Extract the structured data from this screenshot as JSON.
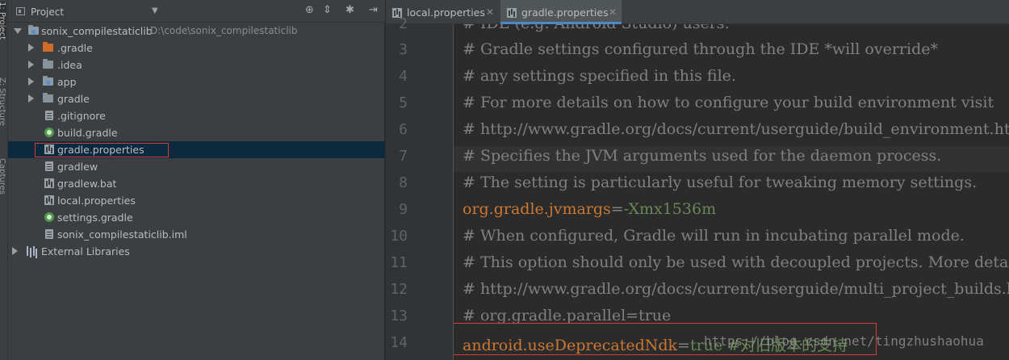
{
  "tool_strip": {
    "project": "1: Project",
    "structure": "Z: Structure",
    "captures": "Captures"
  },
  "project_panel": {
    "title": "Project",
    "header_buttons": [
      "target-icon",
      "collapse-icon",
      "gear-icon",
      "hide-icon"
    ],
    "tree": [
      {
        "label": "sonix_compilestaticlib",
        "path": "D:\\code\\sonix_compilestaticlib",
        "icon": "module-folder-icon",
        "expanded": true
      },
      {
        "label": ".gradle",
        "icon": "folder-icon-orange"
      },
      {
        "label": ".idea",
        "icon": "folder-icon"
      },
      {
        "label": "app",
        "icon": "module-folder-icon"
      },
      {
        "label": "gradle",
        "icon": "folder-icon"
      },
      {
        "label": ".gitignore",
        "icon": "file-icon"
      },
      {
        "label": "build.gradle",
        "icon": "gradle-icon"
      },
      {
        "label": "gradle.properties",
        "icon": "properties-icon",
        "selected": true
      },
      {
        "label": "gradlew",
        "icon": "file-icon"
      },
      {
        "label": "gradlew.bat",
        "icon": "file-icon"
      },
      {
        "label": "local.properties",
        "icon": "properties-icon"
      },
      {
        "label": "settings.gradle",
        "icon": "gradle-icon"
      },
      {
        "label": "sonix_compilestaticlib.iml",
        "icon": "file-icon"
      },
      {
        "label": "External Libraries",
        "icon": "library-icon"
      }
    ]
  },
  "editor": {
    "tabs": [
      {
        "label": "local.properties",
        "active": false
      },
      {
        "label": "gradle.properties",
        "active": true
      }
    ],
    "lines": [
      {
        "num": "2",
        "text": "# IDE (e.g. Android Studio) users:"
      },
      {
        "num": "3",
        "text": "# Gradle settings configured through the IDE *will override*"
      },
      {
        "num": "4",
        "text": "# any settings specified in this file."
      },
      {
        "num": "5",
        "text": "# For more details on how to configure your build environment visit"
      },
      {
        "num": "6",
        "text": "# http://www.gradle.org/docs/current/userguide/build_environment.html"
      },
      {
        "num": "7",
        "text": "# Specifies the JVM arguments used for the daemon process."
      },
      {
        "num": "8",
        "text": "# The setting is particularly useful for tweaking memory settings."
      },
      {
        "num": "9",
        "key": "org.gradle.jvmargs",
        "eq": "=",
        "value": "-Xmx1536m"
      },
      {
        "num": "10",
        "text": "# When configured, Gradle will run in incubating parallel mode."
      },
      {
        "num": "11",
        "text": "# This option should only be used with decoupled projects. More details, visit"
      },
      {
        "num": "12",
        "text": "# http://www.gradle.org/docs/current/userguide/multi_project_builds.html"
      },
      {
        "num": "13",
        "text": "# org.gradle.parallel=true"
      },
      {
        "num": "14",
        "key": "android.useDeprecatedNdk",
        "eq": "=",
        "value": "true #对旧版本的支持"
      }
    ],
    "watermark": "https://blog.csdn.net/tingzhushaohua"
  },
  "colors": {
    "comment": "#808080",
    "key": "#cc7832",
    "value": "#6a8759",
    "selection": "#0d293e",
    "highlight_box": "#d93a3a"
  }
}
